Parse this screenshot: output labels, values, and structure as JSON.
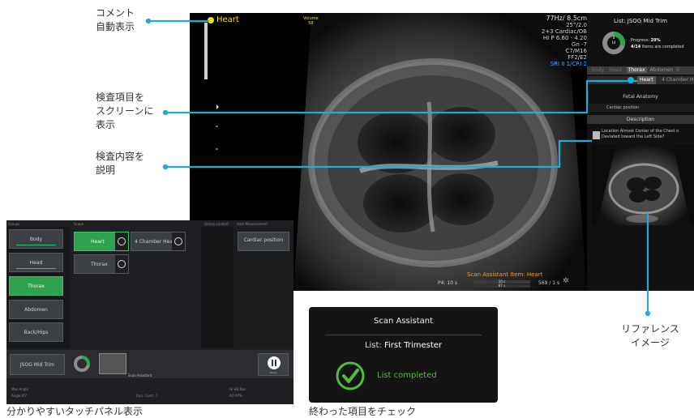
{
  "callouts": {
    "comment": [
      "コメント",
      "自動表示"
    ],
    "item_display": [
      "検査項目を",
      "スクリーンに",
      "表示"
    ],
    "description": [
      "検査内容を",
      "説明"
    ],
    "reference": [
      "リファレンス",
      "イメージ"
    ]
  },
  "captions": {
    "touch_panel": "分かりやすいタッチパネル表示",
    "checked": "終わった項目をチェック"
  },
  "ultrasound": {
    "comment_label": "Heart",
    "volume_label": "Volume",
    "volume_value": "58",
    "params": [
      "77Hz/ 8.5cm",
      "25°/2.0",
      "2+3 Cardiac/OB",
      "HI P 6.60 - 4.20",
      "Gn -7",
      "C7/M16",
      "FF2/E2"
    ],
    "params_blue": "SRI II 1/CRI 2",
    "scan_item": "Scan Assistant Item: Heart",
    "p4": "P4:",
    "p4_value": "10 s",
    "p4_bar1": "10 s",
    "p4_bar2": "87 s",
    "p4_right": "569 / 1 s"
  },
  "side_panel": {
    "list_title": "List: JSOG Mid Trim",
    "donut_done": "4",
    "donut_total": "14",
    "progress_label": "Progress:",
    "progress_value": "29%",
    "progress_detail": "4/14",
    "progress_detail_suffix": "items are completed",
    "tabs": [
      "Body",
      "Head",
      "Thorax",
      "Abdomen",
      "B"
    ],
    "active_tab": "Thorax",
    "sub_items": [
      "Heart",
      "4 Chamber H"
    ],
    "active_sub": "Heart",
    "section_title": "Fetal Anatomy",
    "field_label": "Cardiac position",
    "description_title": "Description",
    "description_text": [
      "Location Almost Center of the Chest o",
      "Deviated toward the Left Side?"
    ]
  },
  "touch_panel": {
    "col_headers": [
      "Groups",
      "Scope",
      "Skinny content",
      "Auto Measurement"
    ],
    "groups": [
      "Body",
      "Head",
      "Thorax",
      "Abdomen",
      "Back/Hips"
    ],
    "active_group": "Thorax",
    "items": [
      "Heart",
      "4 Chamber Heart",
      "Thorax"
    ],
    "active_item": "Heart",
    "measure_button": "Cardiac position",
    "list_button": "JSOG Mid Trim",
    "footer_label": "Scan Assistant",
    "bottom_left": [
      "Max Angle",
      "Angle 65°"
    ],
    "bottom_mid": "Dyn. Contr. 7",
    "bottom_right": [
      "HI HD Res",
      "AO 97%"
    ],
    "pause_label": "Pause"
  },
  "scan_assistant_popup": {
    "title": "Scan Assistant",
    "list_prefix": "List:",
    "list_name": "First Trimester",
    "status": "List completed"
  },
  "colors": {
    "accent_cyan": "#25a9d8",
    "green": "#2ea24f",
    "yellow": "#f1e400"
  }
}
